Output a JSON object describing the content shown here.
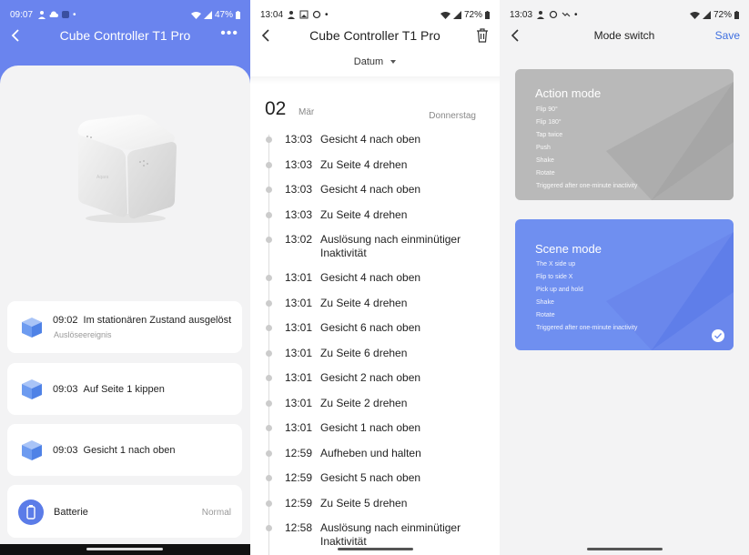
{
  "panel1": {
    "status": {
      "time": "09:07",
      "battery": "47%"
    },
    "title": "Cube Controller T1 Pro",
    "events": [
      {
        "time": "09:02",
        "text": "Im stationären Zustand ausgelöst",
        "sub": "Auslöseereignis"
      },
      {
        "time": "09:03",
        "text": "Auf Seite 1 kippen"
      },
      {
        "time": "09:03",
        "text": "Gesicht 1 nach oben"
      }
    ],
    "battery_card": {
      "label": "Batterie",
      "value": "Normal"
    }
  },
  "panel2": {
    "status": {
      "time": "13:04",
      "battery": "72%"
    },
    "title": "Cube Controller T1 Pro",
    "filter_label": "Datum",
    "date": {
      "day": "02",
      "month": "Mär",
      "weekday": "Donnerstag"
    },
    "entries": [
      {
        "time": "13:03",
        "text": "Gesicht 4 nach oben"
      },
      {
        "time": "13:03",
        "text": "Zu Seite 4 drehen"
      },
      {
        "time": "13:03",
        "text": "Gesicht 4 nach oben"
      },
      {
        "time": "13:03",
        "text": "Zu Seite 4 drehen"
      },
      {
        "time": "13:02",
        "text": "Auslösung nach einminütiger Inaktivität"
      },
      {
        "time": "13:01",
        "text": "Gesicht 4 nach oben"
      },
      {
        "time": "13:01",
        "text": "Zu Seite 4 drehen"
      },
      {
        "time": "13:01",
        "text": "Gesicht 6 nach oben"
      },
      {
        "time": "13:01",
        "text": "Zu Seite 6 drehen"
      },
      {
        "time": "13:01",
        "text": "Gesicht 2 nach oben"
      },
      {
        "time": "13:01",
        "text": "Zu Seite 2 drehen"
      },
      {
        "time": "13:01",
        "text": "Gesicht 1 nach oben"
      },
      {
        "time": "12:59",
        "text": "Aufheben und halten"
      },
      {
        "time": "12:59",
        "text": "Gesicht 5 nach oben"
      },
      {
        "time": "12:59",
        "text": "Zu Seite 5 drehen"
      },
      {
        "time": "12:58",
        "text": "Auslösung nach einminütiger Inaktivität"
      }
    ]
  },
  "panel3": {
    "status": {
      "time": "13:03",
      "battery": "72%"
    },
    "title": "Mode switch",
    "save_label": "Save",
    "action_mode": {
      "title": "Action mode",
      "items": [
        "Flip 90°",
        "Flip 180°",
        "Tap twice",
        "Push",
        "Shake",
        "Rotate",
        "Triggered after one-minute inactivity"
      ],
      "color": "#b9b9b9"
    },
    "scene_mode": {
      "title": "Scene mode",
      "items": [
        "The X side up",
        "Flip to side X",
        "Pick up and hold",
        "Shake",
        "Rotate",
        "Triggered after one-minute inactivity"
      ],
      "color": "#6f8ff0",
      "selected": true
    }
  },
  "colors": {
    "accent": "#6a84ee",
    "save": "#3e6fe0",
    "cube_icon": "#6d9bf0"
  }
}
